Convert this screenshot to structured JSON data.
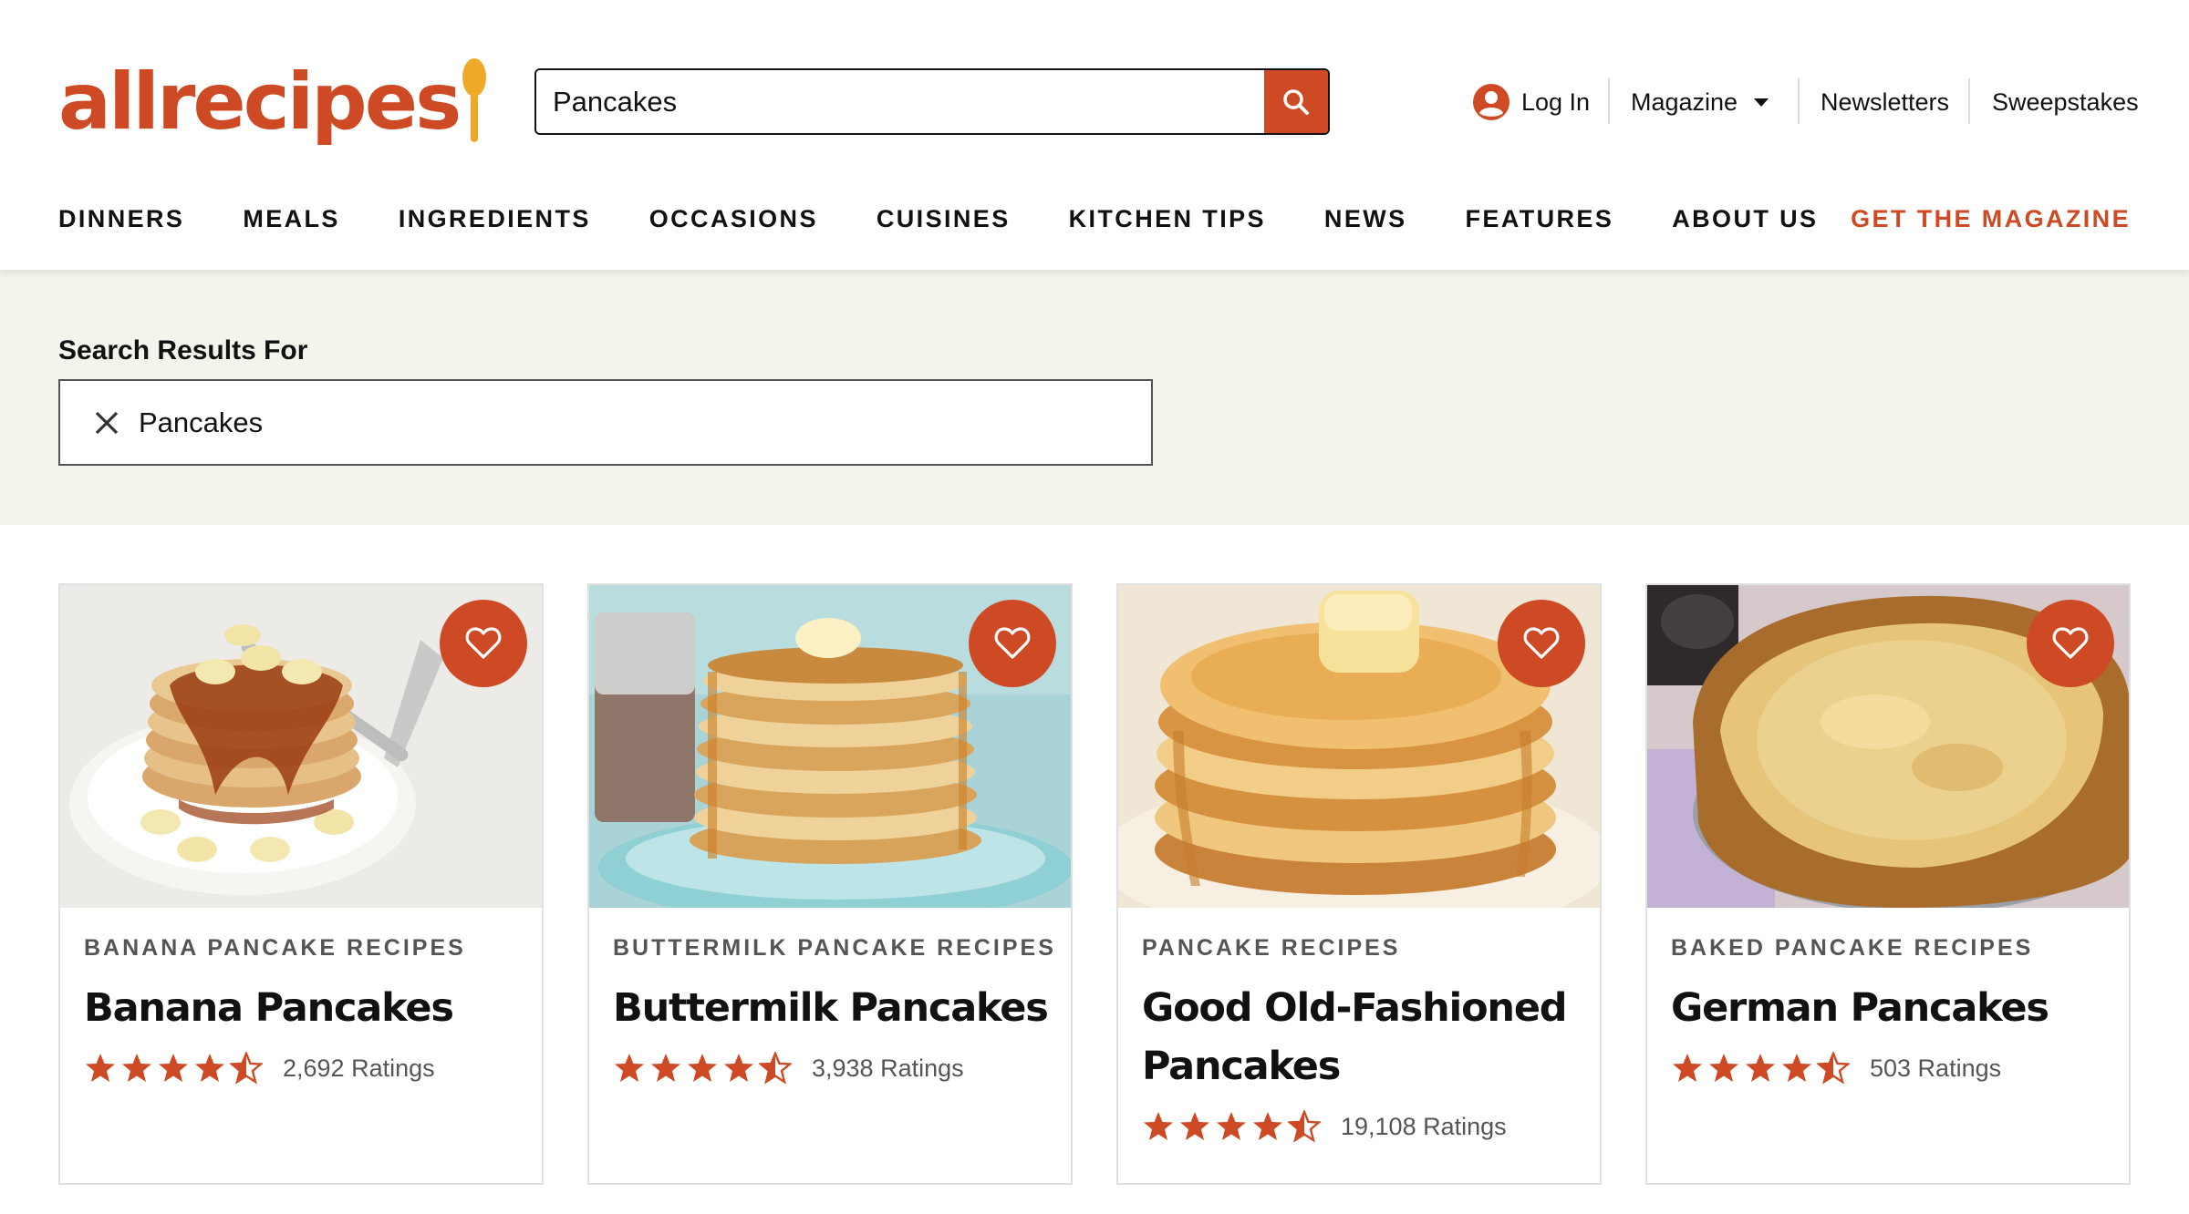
{
  "header": {
    "logo": "allrecipes",
    "search": {
      "value": "Pancakes",
      "placeholder": "Find a recipe or ingredient"
    },
    "links": {
      "login": "Log In",
      "magazine": "Magazine",
      "newsletters": "Newsletters",
      "sweepstakes": "Sweepstakes"
    },
    "nav": [
      "DINNERS",
      "MEALS",
      "INGREDIENTS",
      "OCCASIONS",
      "CUISINES",
      "KITCHEN TIPS",
      "NEWS",
      "FEATURES",
      "ABOUT US"
    ],
    "cta": "GET THE MAGAZINE"
  },
  "results": {
    "heading": "Search Results For",
    "query": "Pancakes"
  },
  "cards": [
    {
      "category": "BANANA PANCAKE RECIPES",
      "title": "Banana Pancakes",
      "rating": 4.5,
      "ratings_text": "2,692 Ratings",
      "photo": "banana-pancakes-photo"
    },
    {
      "category": "BUTTERMILK PANCAKE RECIPES",
      "title": "Buttermilk Pancakes",
      "rating": 4.5,
      "ratings_text": "3,938 Ratings",
      "photo": "buttermilk-pancakes-photo"
    },
    {
      "category": "PANCAKE RECIPES",
      "title": "Good Old-Fashioned Pancakes",
      "rating": 4.5,
      "ratings_text": "19,108 Ratings",
      "photo": "old-fashioned-pancakes-photo"
    },
    {
      "category": "BAKED PANCAKE RECIPES",
      "title": "German Pancakes",
      "rating": 4.5,
      "ratings_text": "503 Ratings",
      "photo": "german-pancakes-photo"
    }
  ],
  "colors": {
    "brand": "#ce4a25",
    "spoon": "#f0a829",
    "band": "#f4f4ec",
    "star": "#ce4a25"
  },
  "icons": [
    "search-icon",
    "user-icon",
    "caret-down-icon",
    "close-icon",
    "heart-icon",
    "star-icon",
    "half-star-icon"
  ]
}
